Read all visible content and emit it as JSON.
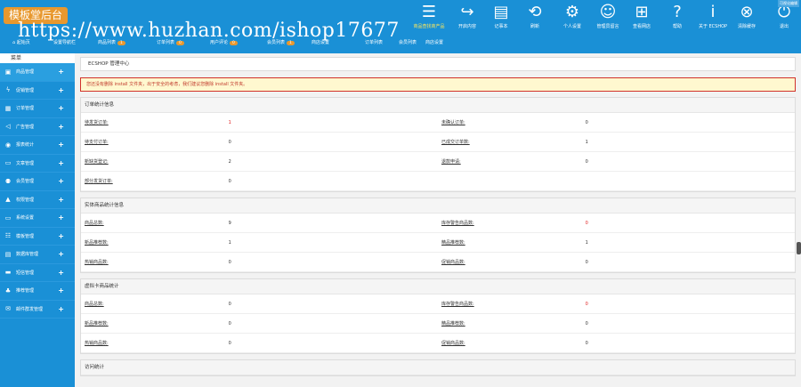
{
  "logo": "模板堂后台",
  "watermark": "https://www.huzhan.com/ishop17677",
  "toolbar": [
    {
      "icon": "menu-icon",
      "label": "商品查找商产品",
      "highlight": true
    },
    {
      "icon": "share-icon",
      "label": "开启内容",
      "highlight": false
    },
    {
      "icon": "notepad-icon",
      "label": "记事本",
      "highlight": false
    },
    {
      "icon": "refresh-icon",
      "label": "刷新",
      "highlight": false
    },
    {
      "icon": "gear-icon",
      "label": "个人设置",
      "highlight": false
    },
    {
      "icon": "message-icon",
      "label": "管理员留言",
      "highlight": false
    },
    {
      "icon": "cart-icon",
      "label": "查看网店",
      "highlight": false
    },
    {
      "icon": "help-icon",
      "label": "帮助",
      "highlight": false
    },
    {
      "icon": "info-icon",
      "label": "关于 ECSHOP",
      "highlight": false
    },
    {
      "icon": "clear-cache-icon",
      "label": "清除缓存",
      "highlight": false
    },
    {
      "icon": "power-icon",
      "label": "退出",
      "highlight": false
    }
  ],
  "corner_label": "可视化编辑",
  "subnav": [
    {
      "label": "起始页",
      "badge": ""
    },
    {
      "label": "设置导航栏",
      "badge": ""
    },
    {
      "label": "商品列表",
      "badge": "1"
    },
    {
      "label": "订单列表",
      "badge": "0"
    },
    {
      "label": "用户评论",
      "badge": "0"
    },
    {
      "label": "会员列表",
      "badge": "1"
    },
    {
      "label": "商店设置",
      "badge": ""
    },
    {
      "label": "订单列表",
      "badge": ""
    },
    {
      "label": "会员列表",
      "badge": ""
    },
    {
      "label": "商店设置",
      "badge": ""
    }
  ],
  "menu_title": "菜单",
  "menu": [
    {
      "icon": "goods-icon",
      "label": "商品管理"
    },
    {
      "icon": "bolt-icon",
      "label": "促销管理"
    },
    {
      "icon": "order-icon",
      "label": "订单管理"
    },
    {
      "icon": "megaphone-icon",
      "label": "广告管理"
    },
    {
      "icon": "report-icon",
      "label": "报表统计"
    },
    {
      "icon": "article-icon",
      "label": "文章管理"
    },
    {
      "icon": "users-icon",
      "label": "会员管理"
    },
    {
      "icon": "lock-icon",
      "label": "权限管理"
    },
    {
      "icon": "monitor-icon",
      "label": "系统设置"
    },
    {
      "icon": "template-icon",
      "label": "模板管理"
    },
    {
      "icon": "database-icon",
      "label": "数据库管理"
    },
    {
      "icon": "chat-icon",
      "label": "短信管理"
    },
    {
      "icon": "thumb-icon",
      "label": "推荐管理"
    },
    {
      "icon": "mail-icon",
      "label": "邮件群发管理"
    }
  ],
  "breadcrumb": "ECSHOP 管理中心",
  "warning": "您还没有删除 install 文件夹，出于安全的考虑，我们建议您删除 install 文件夹。",
  "panels": [
    {
      "title": "订单统计信息",
      "rows": [
        {
          "l1": "待发货订单:",
          "v1": "1",
          "v1_red": true,
          "l2": "未确认订单:",
          "v2": "0",
          "v2_red": false
        },
        {
          "l1": "待支付订单:",
          "v1": "0",
          "v1_red": false,
          "l2": "已成交订单数:",
          "v2": "1",
          "v2_red": false
        },
        {
          "l1": "新缺货登记:",
          "v1": "2",
          "v1_red": false,
          "l2": "退款申请:",
          "v2": "0",
          "v2_red": false
        },
        {
          "l1": "部分发货订单:",
          "v1": "0",
          "v1_red": false,
          "l2": "",
          "v2": "",
          "v2_red": false
        }
      ]
    },
    {
      "title": "实体商品统计信息",
      "rows": [
        {
          "l1": "商品总数:",
          "v1": "9",
          "v1_red": false,
          "l2": "库存警告商品数:",
          "v2": "0",
          "v2_red": true
        },
        {
          "l1": "新品推荐数:",
          "v1": "1",
          "v1_red": false,
          "l2": "精品推荐数:",
          "v2": "1",
          "v2_red": false
        },
        {
          "l1": "热销商品数:",
          "v1": "0",
          "v1_red": false,
          "l2": "促销商品数:",
          "v2": "0",
          "v2_red": false
        }
      ]
    },
    {
      "title": "虚拟卡商品统计",
      "rows": [
        {
          "l1": "商品总数:",
          "v1": "0",
          "v1_red": false,
          "l2": "库存警告商品数:",
          "v2": "0",
          "v2_red": true
        },
        {
          "l1": "新品推荐数:",
          "v1": "0",
          "v1_red": false,
          "l2": "精品推荐数:",
          "v2": "0",
          "v2_red": false
        },
        {
          "l1": "热销商品数:",
          "v1": "0",
          "v1_red": false,
          "l2": "促销商品数:",
          "v2": "0",
          "v2_red": false
        }
      ]
    },
    {
      "title": "访问统计",
      "rows": []
    }
  ]
}
